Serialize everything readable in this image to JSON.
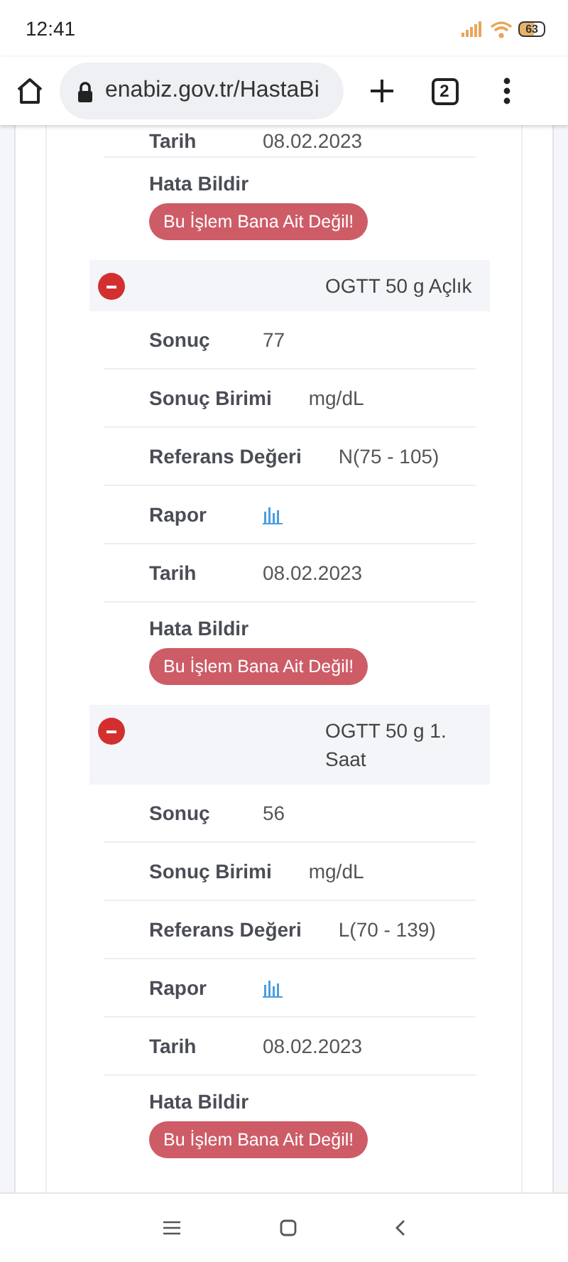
{
  "status_bar": {
    "time": "12:41",
    "battery": "63"
  },
  "browser": {
    "url": "enabiz.gov.tr/HastaBi",
    "tab_count": "2"
  },
  "previous": {
    "rows": [
      {
        "label": "Tarih",
        "value": "08.02.2023",
        "kind": "text"
      }
    ],
    "report_label": "Hata Bildir",
    "report_button": "Bu İşlem Bana Ait Değil!"
  },
  "tests": [
    {
      "title": "OGTT 50 g Açlık",
      "expanded": true,
      "rows": [
        {
          "label": "Sonuç",
          "value": "77",
          "kind": "text"
        },
        {
          "label": "Sonuç Birimi",
          "value": "mg/dL",
          "kind": "text"
        },
        {
          "label": "Referans Değeri",
          "value": "N(75 - 105)",
          "kind": "text"
        },
        {
          "label": "Rapor",
          "kind": "chart-link"
        },
        {
          "label": "Tarih",
          "value": "08.02.2023",
          "kind": "text"
        }
      ],
      "report_label": "Hata Bildir",
      "report_button": "Bu İşlem Bana Ait Değil!"
    },
    {
      "title": "OGTT 50 g 1. Saat",
      "expanded": true,
      "rows": [
        {
          "label": "Sonuç",
          "value": "56",
          "kind": "text"
        },
        {
          "label": "Sonuç Birimi",
          "value": "mg/dL",
          "kind": "text"
        },
        {
          "label": "Referans Değeri",
          "value": "L(70 - 139)",
          "kind": "text"
        },
        {
          "label": "Rapor",
          "kind": "chart-link"
        },
        {
          "label": "Tarih",
          "value": "08.02.2023",
          "kind": "text"
        }
      ],
      "report_label": "Hata Bildir",
      "report_button": "Bu İşlem Bana Ait Değil!"
    }
  ]
}
